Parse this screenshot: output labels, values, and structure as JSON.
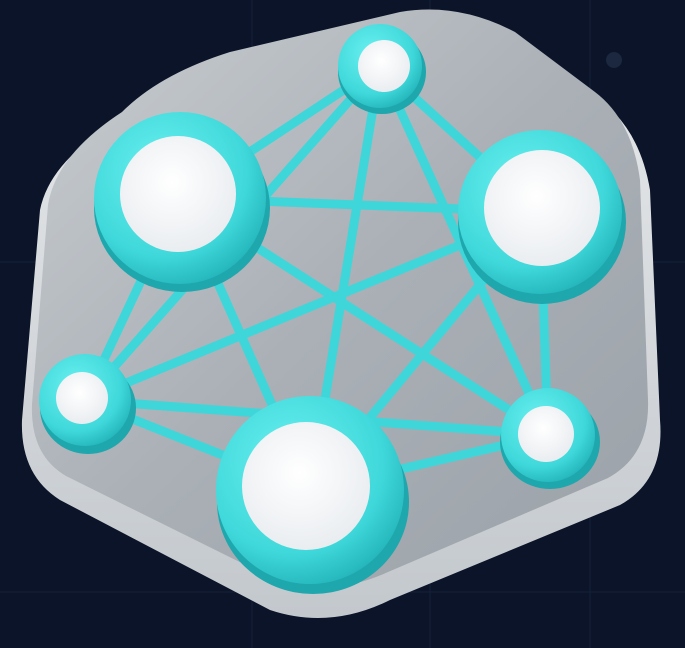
{
  "scene": {
    "subject": "network-graph-icon",
    "colors": {
      "background": "#0b1428",
      "grid_line": "#16223a",
      "plate_top": "#b8bdc2",
      "plate_edge": "#8e959c",
      "plate_side": "#d9dde1",
      "node_ring": "#42dfe0",
      "node_ring_dark": "#1fa9b0",
      "node_core": "#ffffff",
      "edge": "#3fd6da"
    },
    "node_count": 6,
    "edge_count": 15
  }
}
